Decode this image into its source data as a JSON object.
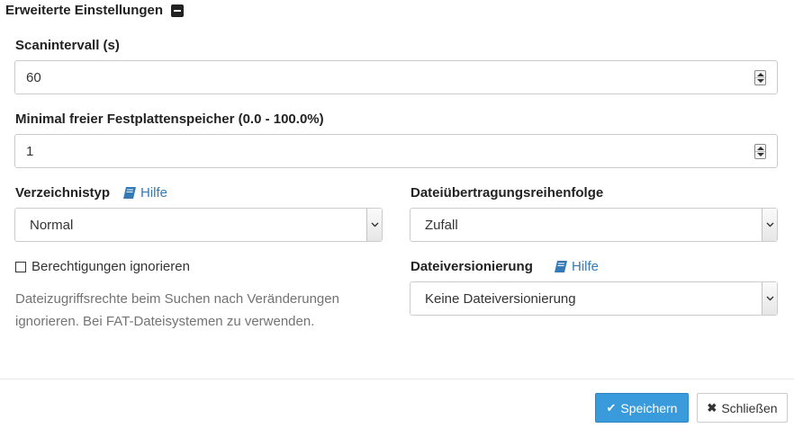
{
  "section": {
    "title": "Erweiterte Einstellungen",
    "collapse_icon": "minus-square-icon"
  },
  "scan_interval": {
    "label": "Scanintervall (s)",
    "value": "60"
  },
  "min_disk": {
    "label": "Minimal freier Festplattenspeicher (0.0 - 100.0%)",
    "value": "1"
  },
  "folder_type": {
    "label": "Verzeichnistyp",
    "help": "Hilfe",
    "selected": "Normal"
  },
  "pull_order": {
    "label": "Dateiübertragungsreihenfolge",
    "selected": "Zufall"
  },
  "ignore_perms": {
    "label": "Berechtigungen ignorieren",
    "checked": false,
    "description": "Dateizugriffsrechte beim Suchen nach Veränderungen ignorieren. Bei FAT-Dateisystemen zu verwenden."
  },
  "versioning": {
    "label": "Dateiversionierung",
    "help": "Hilfe",
    "selected": "Keine Dateiversionierung"
  },
  "footer": {
    "save_label": "Speichern",
    "close_label": "Schließen",
    "save_icon": "check-icon",
    "close_icon": "times-icon"
  },
  "colors": {
    "primary": "#3a9bdc",
    "link": "#337ab7"
  }
}
